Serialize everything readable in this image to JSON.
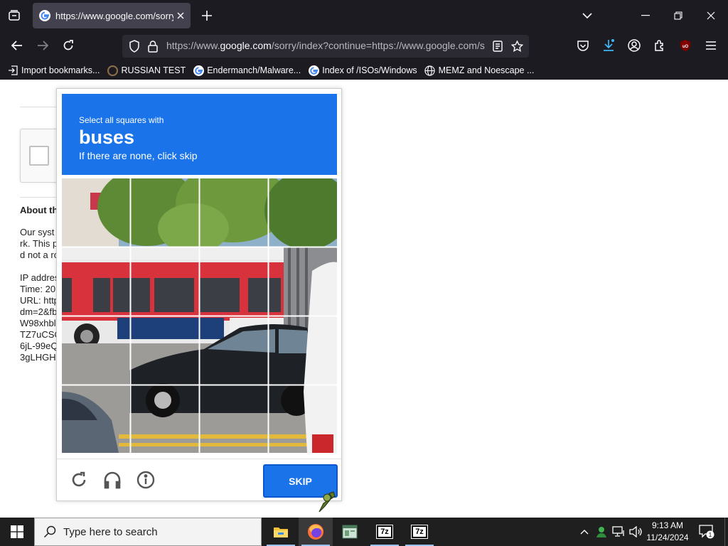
{
  "browser": {
    "tab": {
      "title": "https://www.google.com/sorry/index?continue=https://www.google.com/"
    },
    "url": {
      "prefix": "https://www.",
      "domain": "google.com",
      "suffix": "/sorry/index?continue=https://www.google.com/s"
    },
    "bookmarks": [
      {
        "label": "Import bookmarks...",
        "icon": "import-icon"
      },
      {
        "label": "RUSSIAN TEST",
        "icon": "site-favicon"
      },
      {
        "label": "Endermanch/Malware...",
        "icon": "google-favicon"
      },
      {
        "label": "Index of /ISOs/Windows",
        "icon": "google-favicon"
      },
      {
        "label": "MEMZ and Noescape ...",
        "icon": "globe-icon"
      }
    ]
  },
  "page": {
    "about_heading": "About th",
    "about_lines": [
      "Our syst",
      "rk. This p",
      "d not a ro",
      "",
      "IP addres",
      "Time: 20",
      "URL: http",
      "dm=2&fb",
      "W98xhbl",
      "TZ7uCSC",
      "6jL-99eQ",
      "3gLHGH("
    ]
  },
  "captcha": {
    "line1": "Select all squares with",
    "target": "buses",
    "line3": "If there are none, click skip",
    "skip_label": "SKIP",
    "accent_color": "#1a73e8",
    "footer_icons": [
      "reload-icon",
      "headphones-icon",
      "info-icon"
    ]
  },
  "taskbar": {
    "search_placeholder": "Type here to search",
    "apps": [
      "file-explorer",
      "firefox",
      "terminal",
      "7zip",
      "7zip"
    ],
    "sevenzip_label": "7z",
    "time": "9:13 AM",
    "date": "11/24/2024",
    "notification_count": "1"
  }
}
